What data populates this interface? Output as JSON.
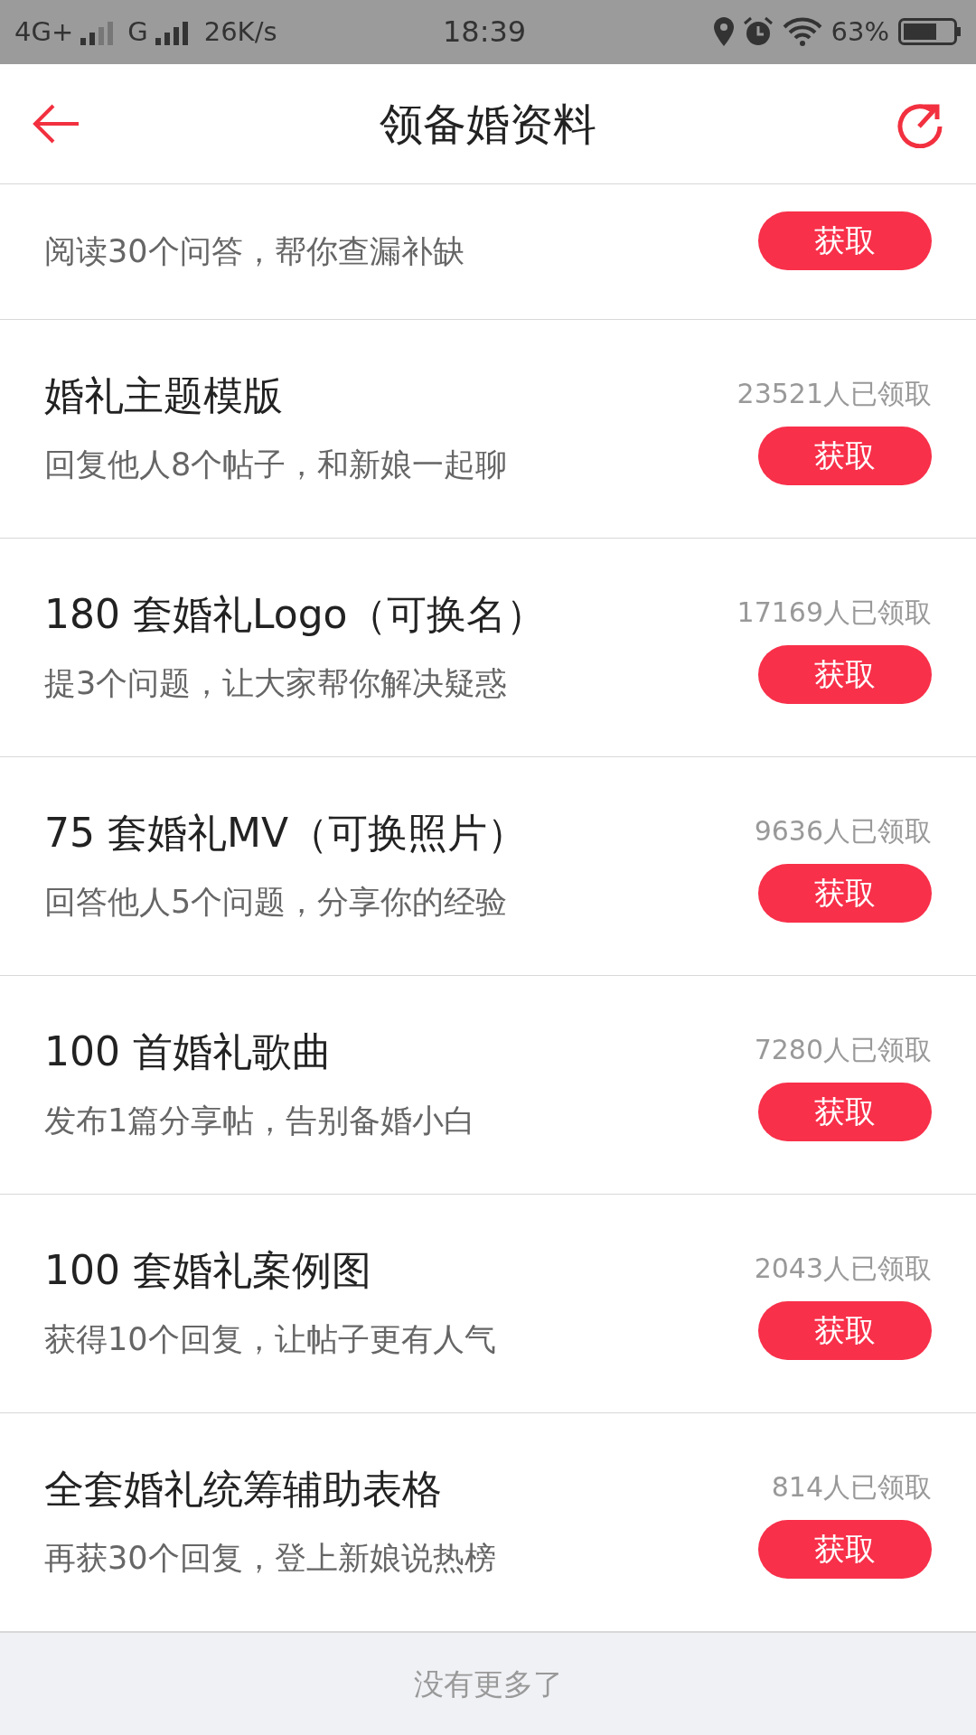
{
  "status_bar": {
    "network_1": "4G+",
    "network_2": "G",
    "speed": "26K/s",
    "time": "18:39",
    "battery": "63%"
  },
  "nav": {
    "title": "领备婚资料"
  },
  "items": [
    {
      "subtitle": "阅读30个问答，帮你查漏补缺",
      "button": "获取"
    },
    {
      "title": "婚礼主题模版",
      "count": "23521人已领取",
      "subtitle": "回复他人8个帖子，和新娘一起聊",
      "button": "获取"
    },
    {
      "title": "180 套婚礼Logo（可换名）",
      "count": "17169人已领取",
      "subtitle": "提3个问题，让大家帮你解决疑惑",
      "button": "获取"
    },
    {
      "title": "75 套婚礼MV（可换照片）",
      "count": "9636人已领取",
      "subtitle": "回答他人5个问题，分享你的经验",
      "button": "获取"
    },
    {
      "title": "100 首婚礼歌曲",
      "count": "7280人已领取",
      "subtitle": "发布1篇分享帖，告别备婚小白",
      "button": "获取"
    },
    {
      "title": "100 套婚礼案例图",
      "count": "2043人已领取",
      "subtitle": "获得10个回复，让帖子更有人气",
      "button": "获取"
    },
    {
      "title": "全套婚礼统筹辅助表格",
      "count": "814人已领取",
      "subtitle": "再获30个回复，登上新娘说热榜",
      "button": "获取"
    }
  ],
  "footer": "没有更多了"
}
